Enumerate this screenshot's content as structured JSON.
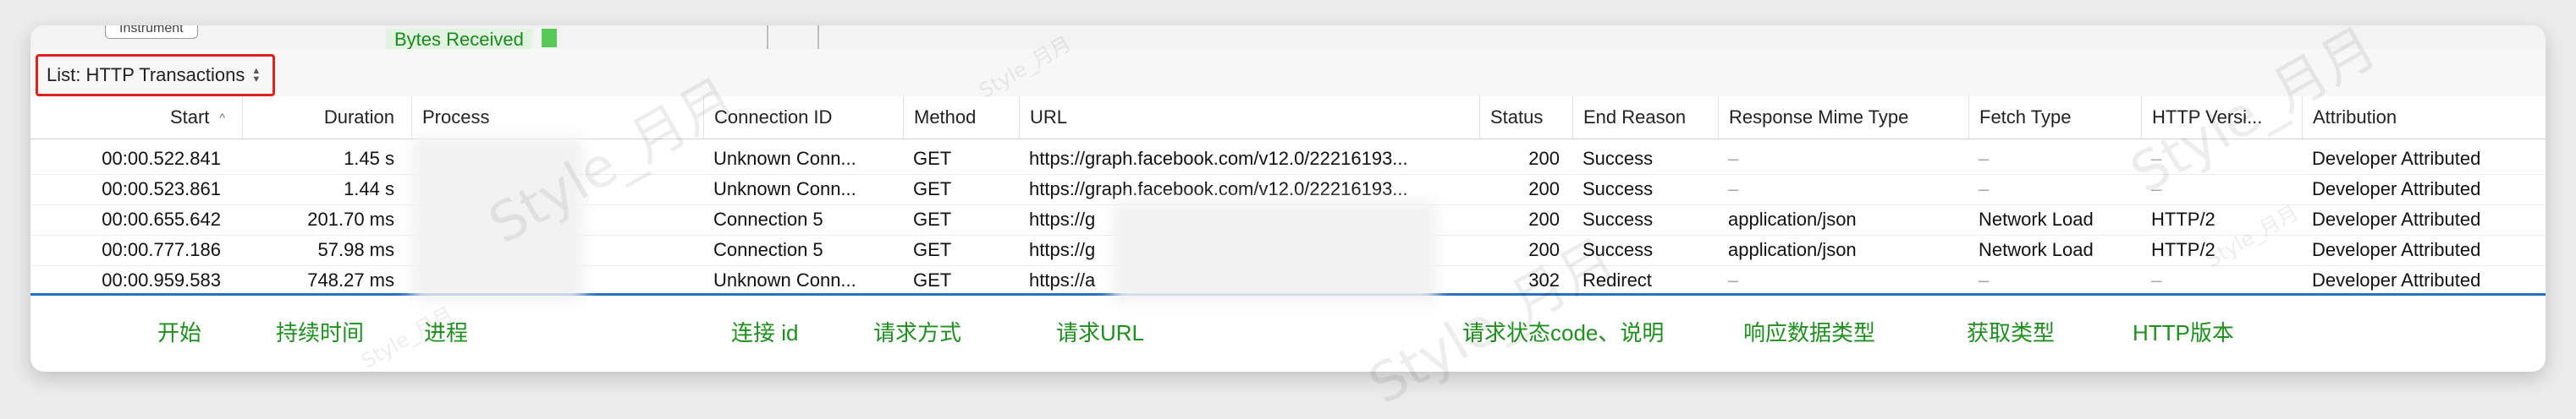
{
  "upper_track": {
    "instrument_label": "Instrument",
    "metric_label": "Bytes Received"
  },
  "toolbar": {
    "list_selector_value": "List: HTTP Transactions",
    "selector_icon": "chevron-updown-icon",
    "highlight_color": "#e0221c"
  },
  "table": {
    "columns": [
      {
        "label": "Start",
        "sorted": "ascending"
      },
      {
        "label": "Duration"
      },
      {
        "label": "Process"
      },
      {
        "label": "Connection ID"
      },
      {
        "label": "Method"
      },
      {
        "label": "URL"
      },
      {
        "label": "Status"
      },
      {
        "label": "End Reason"
      },
      {
        "label": "Response Mime Type"
      },
      {
        "label": "Fetch Type"
      },
      {
        "label": "HTTP Versi..."
      },
      {
        "label": "Attribution"
      }
    ],
    "rows": [
      {
        "start": "00:00.522.841",
        "duration": "1.45 s",
        "connection": "Unknown Conn...",
        "method": "GET",
        "url": "https://graph.facebook.com/v12.0/22216193...",
        "status": "200",
        "end_reason": "Success",
        "mime": "–",
        "fetch": "–",
        "http_version": "–",
        "attribution": "Developer Attributed"
      },
      {
        "start": "00:00.523.861",
        "duration": "1.44 s",
        "connection": "Unknown Conn...",
        "method": "GET",
        "url": "https://graph.facebook.com/v12.0/22216193...",
        "status": "200",
        "end_reason": "Success",
        "mime": "–",
        "fetch": "–",
        "http_version": "–",
        "attribution": "Developer Attributed"
      },
      {
        "start": "00:00.655.642",
        "duration": "201.70 ms",
        "connection": "Connection 5",
        "method": "GET",
        "url": "https://g",
        "status": "200",
        "end_reason": "Success",
        "mime": "application/json",
        "fetch": "Network Load",
        "http_version": "HTTP/2",
        "attribution": "Developer Attributed"
      },
      {
        "start": "00:00.777.186",
        "duration": "57.98 ms",
        "connection": "Connection 5",
        "method": "GET",
        "url": "https://g",
        "status": "200",
        "end_reason": "Success",
        "mime": "application/json",
        "fetch": "Network Load",
        "http_version": "HTTP/2",
        "attribution": "Developer Attributed"
      },
      {
        "start": "00:00.959.583",
        "duration": "748.27 ms",
        "connection": "Unknown Conn...",
        "method": "GET",
        "url": "https://a",
        "status": "302",
        "end_reason": "Redirect",
        "mime": "–",
        "fetch": "–",
        "http_version": "–",
        "attribution": "Developer Attributed"
      }
    ]
  },
  "annotations": {
    "start": "开始",
    "duration": "持续时间",
    "process": "进程",
    "connection": "连接 id",
    "method": "请求方式",
    "url": "请求URL",
    "status": "请求状态code、说明",
    "mime": "响应数据类型",
    "fetch": "获取类型",
    "http_version": "HTTP版本",
    "color": "#1f8f1f"
  },
  "watermark": {
    "text": "Style_月月"
  }
}
